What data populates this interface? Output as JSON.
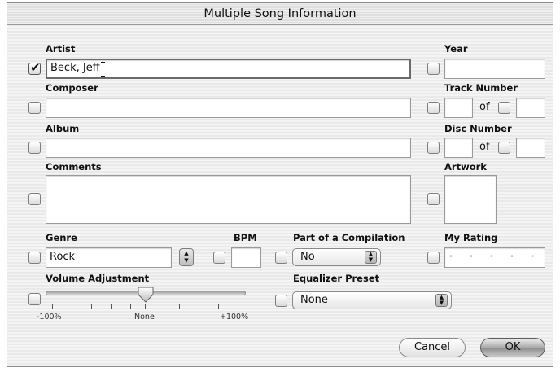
{
  "window": {
    "title": "Multiple Song Information"
  },
  "fields": {
    "artist": {
      "label": "Artist",
      "value": "Beck, Jeff",
      "checked": true
    },
    "year": {
      "label": "Year",
      "value": ""
    },
    "composer": {
      "label": "Composer",
      "value": ""
    },
    "track_number": {
      "label": "Track Number",
      "of": "of"
    },
    "album": {
      "label": "Album",
      "value": ""
    },
    "disc_number": {
      "label": "Disc Number",
      "of": "of"
    },
    "comments": {
      "label": "Comments",
      "value": ""
    },
    "artwork": {
      "label": "Artwork"
    },
    "genre": {
      "label": "Genre",
      "value": "Rock"
    },
    "bpm": {
      "label": "BPM",
      "value": ""
    },
    "compilation": {
      "label": "Part of a Compilation",
      "value": "No"
    },
    "my_rating": {
      "label": "My Rating",
      "placeholder": "• • • • •",
      "stars": 0
    },
    "volume": {
      "label": "Volume Adjustment",
      "min_label": "-100%",
      "mid_label": "None",
      "max_label": "+100%",
      "value": 0
    },
    "equalizer": {
      "label": "Equalizer Preset",
      "value": "None"
    }
  },
  "buttons": {
    "cancel": "Cancel",
    "ok": "OK"
  },
  "icons": {
    "checkbox_checked": "checkmark-icon",
    "popup_arrows": "updown-arrows-icon"
  }
}
